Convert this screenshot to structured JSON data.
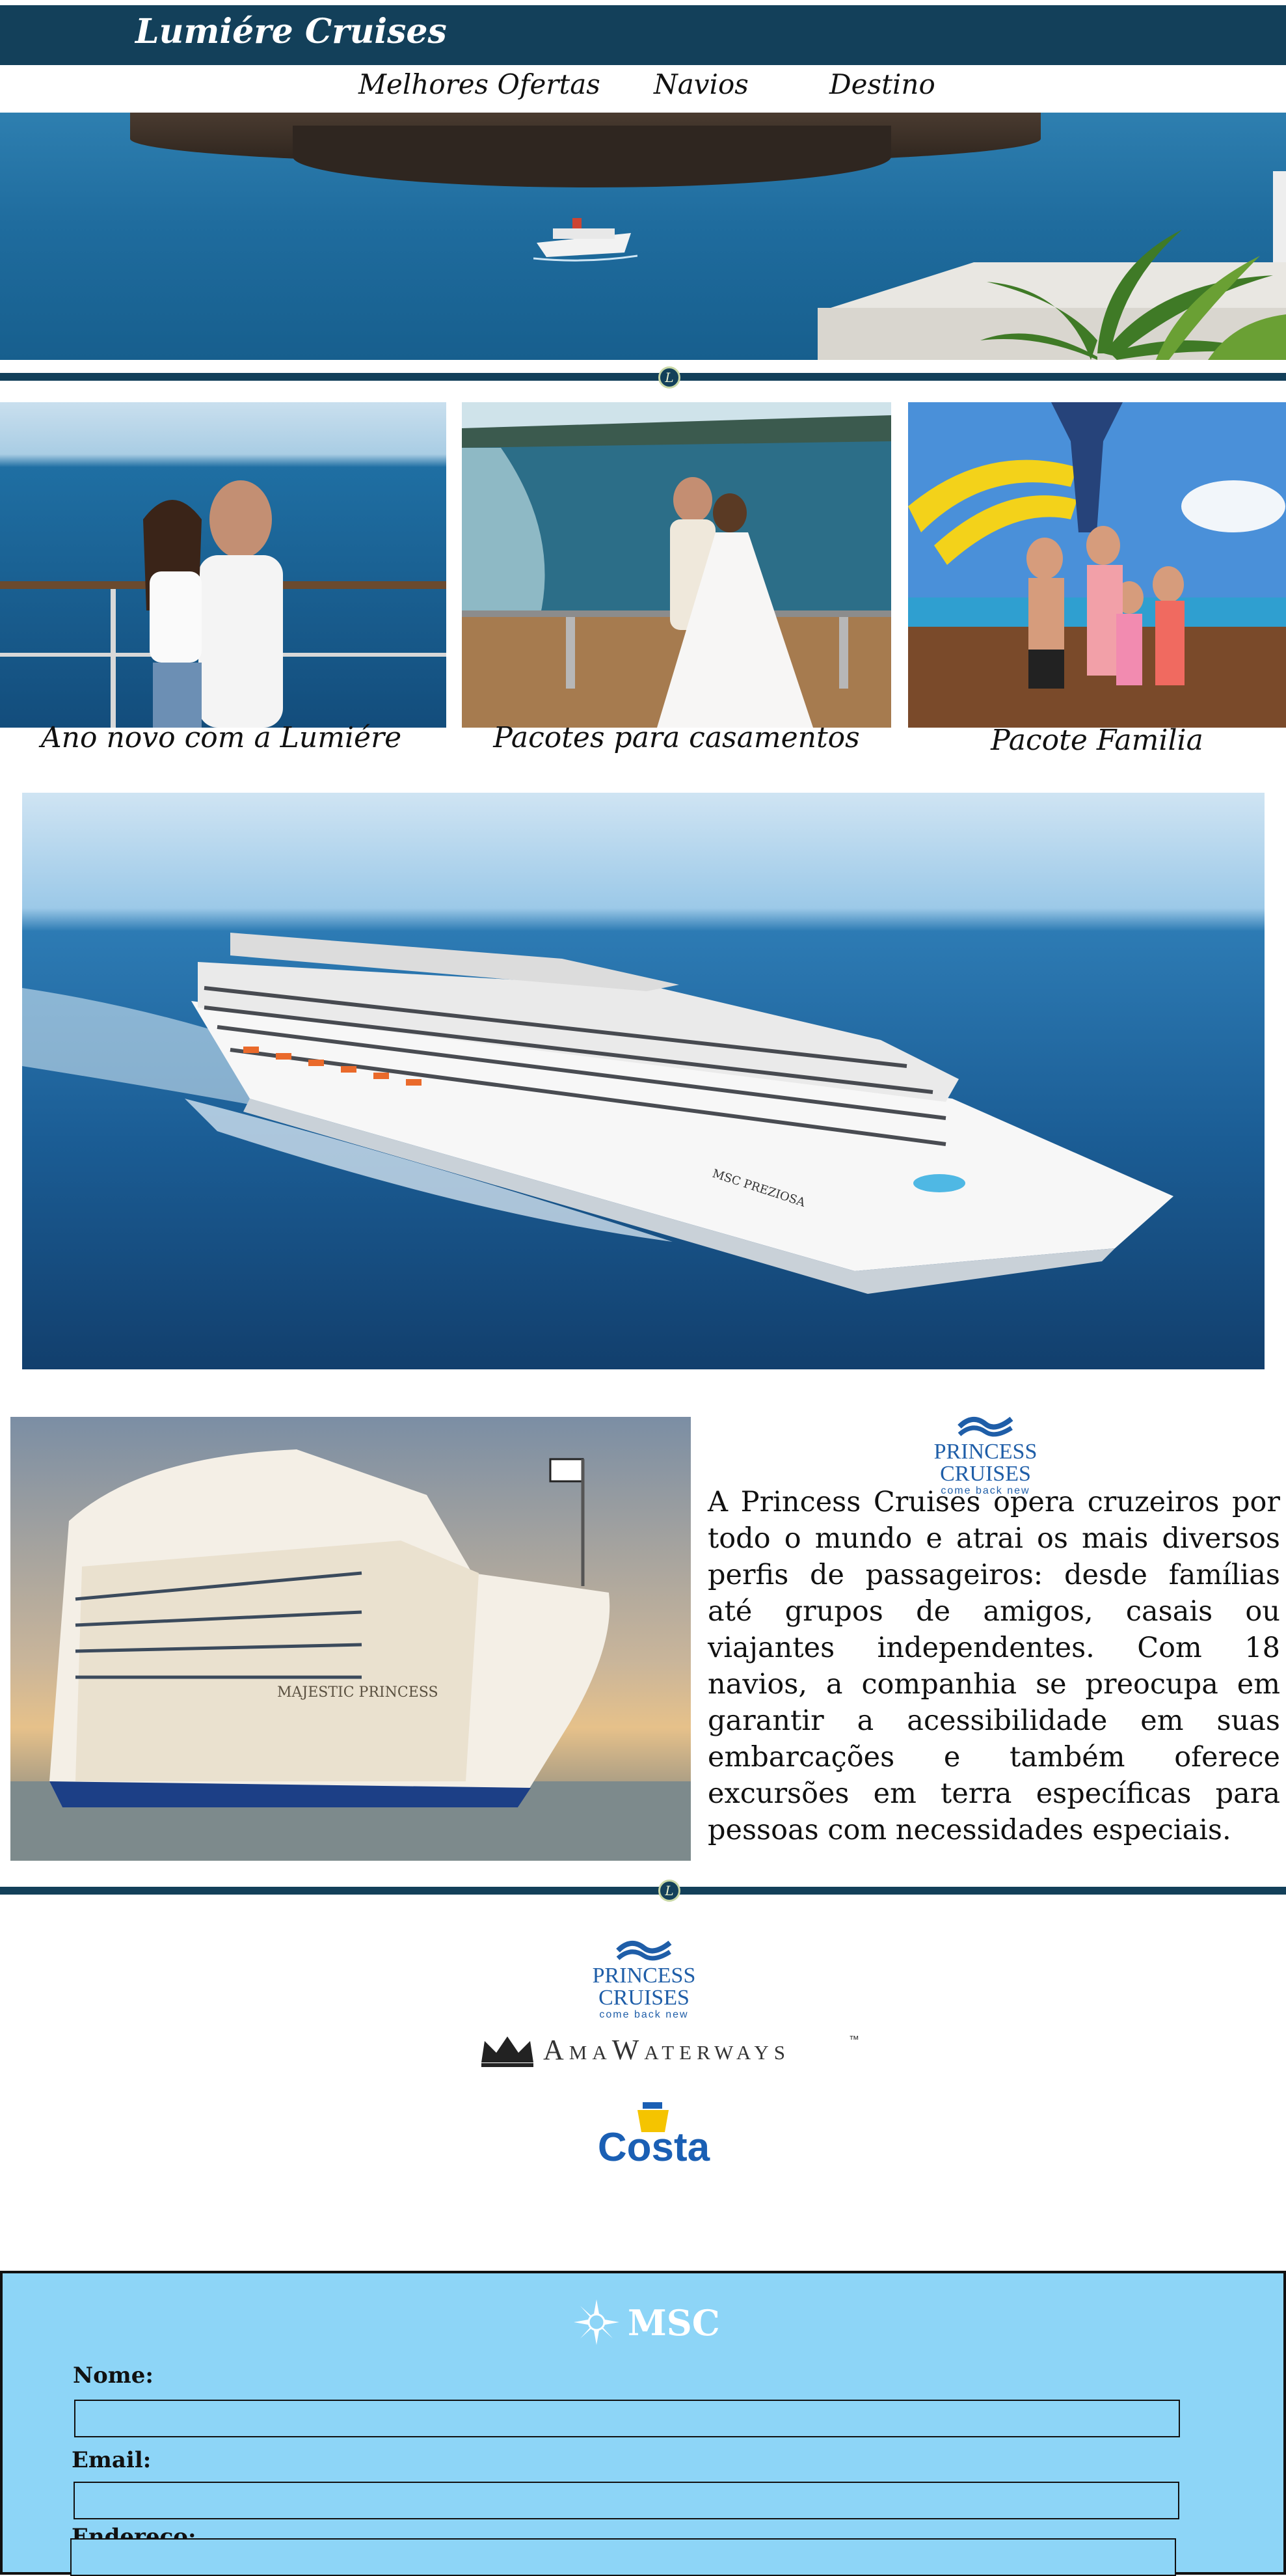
{
  "header": {
    "brand": "Lumiére Cruises"
  },
  "nav": [
    {
      "label": "Melhores Ofertas"
    },
    {
      "label": "Navios"
    },
    {
      "label": "Destino"
    }
  ],
  "divider_badge": "L",
  "offers": [
    {
      "caption": "Ano novo com a Lumiére"
    },
    {
      "caption": "Pacotes para casamentos"
    },
    {
      "caption": "Pacote Familia"
    }
  ],
  "big_ship": {
    "hull_name": "MSC PREZIOSA"
  },
  "princess": {
    "logo_name": "PRINCESS CRUISES",
    "logo_tagline": "come back new",
    "ship_name": "MAJESTIC PRINCESS",
    "description": "A Princess Cruises opera cruzeiros por todo o mundo e atrai os mais diversos perfis de passageiros: desde famílias até grupos de amigos, casais ou viajantes independentes. Com 18 navios, a companhia se preocupa em garantir a acessibilidade em suas embarcações e também oferece excursões em terra específicas para pessoas com necessidades especiais."
  },
  "partners": {
    "princess_name": "PRINCESS CRUISES",
    "princess_tagline": "come back new",
    "ama": "AmaWaterways",
    "ama_tm": "™",
    "costa": "Costa"
  },
  "form": {
    "logo": "MSC",
    "name_label": "Nome:",
    "email_label": "Email:",
    "address_label": "Endereço:",
    "name_value": "",
    "email_value": "",
    "address_value": ""
  },
  "colors": {
    "header_bg": "#13405a",
    "form_bg": "#8dd5f7",
    "princess_blue": "#1f5ea8",
    "costa_blue": "#1a5fb4",
    "costa_yellow": "#f5c400"
  }
}
